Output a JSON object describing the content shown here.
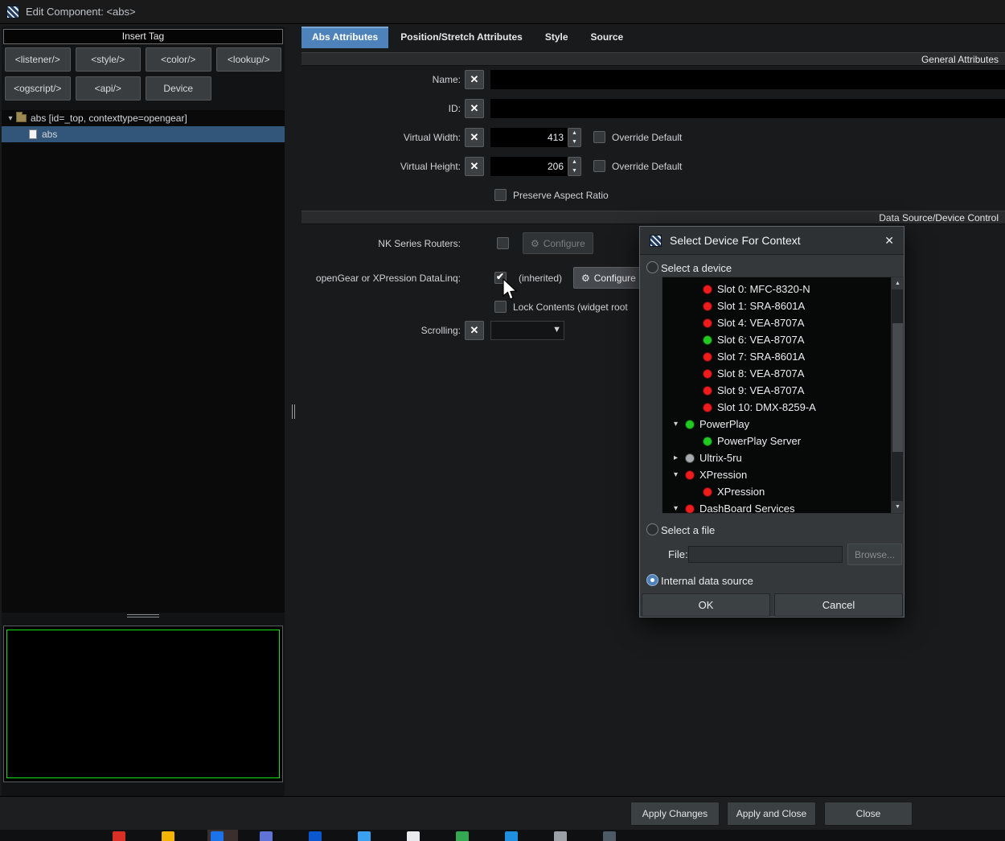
{
  "colors": {
    "red": "#ee1c1c",
    "green": "#22c922",
    "gray": "#a8acb0",
    "accent": "#4d82ba"
  },
  "window": {
    "title": "Edit Component: <abs>"
  },
  "left_panel": {
    "insert_tag_header": "Insert Tag",
    "insert_tag_buttons": [
      "<listener/>",
      "<style/>",
      "<color/>",
      "<lookup/>",
      "<ogscript/>",
      "<api/>",
      "Device"
    ],
    "tree_root": "abs [id=_top, contexttype=opengear]",
    "tree_child": "abs"
  },
  "tabs": [
    {
      "label": "Abs Attributes",
      "selected": true
    },
    {
      "label": "Position/Stretch Attributes",
      "selected": false
    },
    {
      "label": "Style",
      "selected": false
    },
    {
      "label": "Source",
      "selected": false
    }
  ],
  "general": {
    "section_title": "General Attributes",
    "name_label": "Name:",
    "id_label": "ID:",
    "virtual_width_label": "Virtual Width:",
    "virtual_width_value": "413",
    "virtual_height_label": "Virtual Height:",
    "virtual_height_value": "206",
    "override_default_label": "Override Default",
    "preserve_aspect_label": "Preserve Aspect Ratio"
  },
  "data_source": {
    "section_title": "Data Source/Device Control",
    "nk_routers_label": "NK Series Routers:",
    "configure_label": "Configure",
    "datalinq_label": "openGear or XPression DataLinq:",
    "inherited_label": "(inherited)",
    "lock_contents_label": "Lock Contents (widget root",
    "scrolling_label": "Scrolling:"
  },
  "dialog": {
    "title": "Select Device For Context",
    "select_device_label": "Select a device",
    "select_file_label": "Select a file",
    "file_label": "File:",
    "file_value": "",
    "browse_label": "Browse...",
    "internal_label": "Internal data source",
    "ok_label": "OK",
    "cancel_label": "Cancel",
    "tree": [
      {
        "label": "Slot 0: MFC-8320-N",
        "status": "red",
        "indent": 2
      },
      {
        "label": "Slot 1: SRA-8601A",
        "status": "red",
        "indent": 2
      },
      {
        "label": "Slot 4: VEA-8707A",
        "status": "red",
        "indent": 2
      },
      {
        "label": "Slot 6: VEA-8707A",
        "status": "green",
        "indent": 2
      },
      {
        "label": "Slot 7: SRA-8601A",
        "status": "red",
        "indent": 2
      },
      {
        "label": "Slot 8: VEA-8707A",
        "status": "red",
        "indent": 2
      },
      {
        "label": "Slot 9: VEA-8707A",
        "status": "red",
        "indent": 2
      },
      {
        "label": "Slot 10: DMX-8259-A",
        "status": "red",
        "indent": 2
      },
      {
        "label": "PowerPlay",
        "status": "green",
        "indent": 1,
        "arrow": "expanded"
      },
      {
        "label": "PowerPlay Server",
        "status": "green",
        "indent": 2
      },
      {
        "label": "Ultrix-5ru",
        "status": "gray",
        "indent": 1,
        "arrow": "collapsed"
      },
      {
        "label": "XPression",
        "status": "red",
        "indent": 1,
        "arrow": "expanded"
      },
      {
        "label": "XPression",
        "status": "red",
        "indent": 2
      },
      {
        "label": "DashBoard Services",
        "status": "red",
        "indent": 1,
        "arrow": "expanded"
      }
    ]
  },
  "footer": {
    "apply": "Apply Changes",
    "apply_close": "Apply and Close",
    "close": "Close"
  },
  "taskbar": {
    "icons": [
      "#d93025",
      "#f5b400",
      "#1a73e8",
      "#6074d8",
      "#0b57d0",
      "#3aa0f0",
      "#e8eaed",
      "#34a853",
      "#1f8fe0",
      "#9aa0a6",
      "#4d5a66"
    ]
  }
}
